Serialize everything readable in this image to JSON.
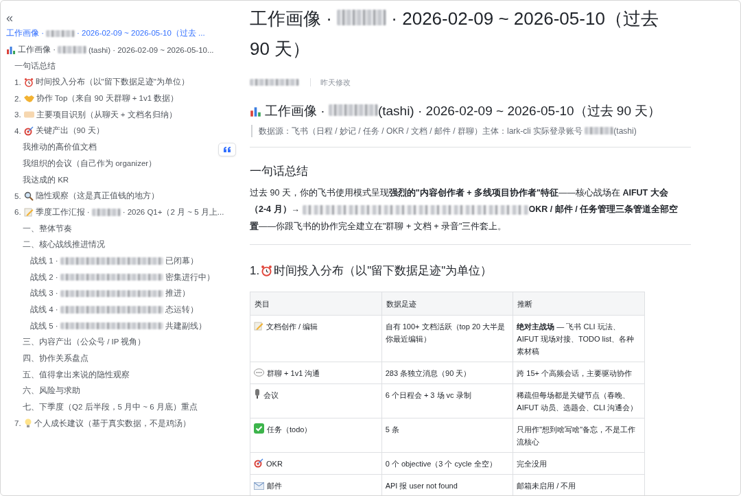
{
  "sidebar": {
    "collapse_glyph": "«",
    "items": [
      {
        "label": [
          {
            "kind": "text",
            "text": "工作画像 · "
          },
          {
            "kind": "redacted"
          },
          {
            "kind": "text",
            "text": " · 2026-02-09 ~ 2026-05-10（过去 ..."
          }
        ],
        "selected": true
      },
      {
        "label": [
          {
            "kind": "text",
            "text": "工作画像 · "
          },
          {
            "kind": "redacted"
          },
          {
            "kind": "text",
            "text": "(tashi) · 2026-02-09 ~ 2026-05-10..."
          }
        ],
        "selected": false,
        "children": [
          {
            "label": [
              {
                "kind": "text",
                "text": "一句话总结"
              }
            ],
            "selected": false
          },
          {
            "number": "1.",
            "label": [
              {
                "kind": "text",
                "text": "时间投入分布（以\"留下数据足迹\"为单位）"
              }
            ],
            "selected": false
          },
          {
            "number": "2.",
            "label": [
              {
                "kind": "text",
                "text": "协作 Top（来自 90 天群聊 + 1v1 数据）"
              }
            ],
            "selected": false
          },
          {
            "number": "3.",
            "label": [
              {
                "kind": "text",
                "text": "主要项目识别（从聊天 + 文档名归纳）"
              }
            ],
            "selected": false
          },
          {
            "number": "4.",
            "label": [
              {
                "kind": "text",
                "text": "关键产出（90 天）"
              }
            ],
            "selected": false,
            "children": [
              {
                "label": [
                  {
                    "kind": "text",
                    "text": "我推动的高价值文档"
                  }
                ],
                "selected": false
              },
              {
                "label": [
                  {
                    "kind": "text",
                    "text": "我组织的会议（自己作为 organizer）"
                  }
                ],
                "selected": false
              },
              {
                "label": [
                  {
                    "kind": "text",
                    "text": "我达成的 KR"
                  }
                ],
                "selected": false
              }
            ]
          },
          {
            "number": "5.",
            "label": [
              {
                "kind": "text",
                "text": "隐性观察（这是真正值钱的地方）"
              }
            ],
            "selected": false
          },
          {
            "number": "6.",
            "label": [
              {
                "kind": "text",
                "text": "季度工作汇报 · "
              },
              {
                "kind": "redacted"
              },
              {
                "kind": "text",
                "text": " · 2026 Q1+（2 月 ~ 5 月上..."
              }
            ],
            "selected": false,
            "children": [
              {
                "label": [
                  {
                    "kind": "text",
                    "text": "一、整体节奏"
                  }
                ],
                "selected": false
              },
              {
                "label": [
                  {
                    "kind": "text",
                    "text": "二、核心战线推进情况"
                  }
                ],
                "selected": false,
                "children": [
                  {
                    "label": [
                      {
                        "kind": "text",
                        "text": "战线 1 · "
                      },
                      {
                        "kind": "redacted"
                      },
                      {
                        "kind": "text",
                        "text": "已闭幕）"
                      }
                    ],
                    "selected": false
                  },
                  {
                    "label": [
                      {
                        "kind": "text",
                        "text": "战线 2 · "
                      },
                      {
                        "kind": "redacted"
                      },
                      {
                        "kind": "text",
                        "text": "密集进行中）"
                      }
                    ],
                    "selected": false
                  },
                  {
                    "label": [
                      {
                        "kind": "text",
                        "text": "战线 3 · "
                      },
                      {
                        "kind": "redacted"
                      },
                      {
                        "kind": "text",
                        "text": "推进）"
                      }
                    ],
                    "selected": false
                  },
                  {
                    "label": [
                      {
                        "kind": "text",
                        "text": "战线 4 · "
                      },
                      {
                        "kind": "redacted"
                      },
                      {
                        "kind": "text",
                        "text": "态运转）"
                      }
                    ],
                    "selected": false
                  },
                  {
                    "label": [
                      {
                        "kind": "text",
                        "text": "战线 5 · "
                      },
                      {
                        "kind": "redacted"
                      },
                      {
                        "kind": "text",
                        "text": "共建副线）"
                      }
                    ],
                    "selected": false
                  }
                ]
              },
              {
                "label": [
                  {
                    "kind": "text",
                    "text": "三、内容产出（公众号 / IP 视角）"
                  }
                ],
                "selected": false
              },
              {
                "label": [
                  {
                    "kind": "text",
                    "text": "四、协作关系盘点"
                  }
                ],
                "selected": false
              },
              {
                "label": [
                  {
                    "kind": "text",
                    "text": "五、值得拿出来说的隐性观察"
                  }
                ],
                "selected": false
              },
              {
                "label": [
                  {
                    "kind": "text",
                    "text": "六、风险与求助"
                  }
                ],
                "selected": false
              },
              {
                "label": [
                  {
                    "kind": "text",
                    "text": "七、下季度（Q2 后半段，5 月中 ~ 6 月底）重点"
                  }
                ],
                "selected": false
              }
            ]
          },
          {
            "number": "7.",
            "label": [
              {
                "kind": "text",
                "text": "个人成长建议（基于真实数据，不是鸡汤）"
              }
            ],
            "selected": false
          }
        ]
      }
    ]
  },
  "document": {
    "title": [
      {
        "kind": "text",
        "text": "工作画像 · "
      },
      {
        "kind": "redacted"
      },
      {
        "kind": "text",
        "text": " · 2026-02-09 ~ 2026-05-10（过去 90 天）"
      }
    ],
    "meta": {
      "author": [
        {
          "kind": "redacted"
        }
      ],
      "modified": "昨天修改"
    },
    "heading": [
      {
        "kind": "text",
        "text": "工作画像 · "
      },
      {
        "kind": "redacted"
      },
      {
        "kind": "text",
        "text": "(tashi) · 2026-02-09 ~ 2026-05-10（过去 90 天）"
      }
    ],
    "quote": [
      {
        "kind": "text",
        "text": "数据源：飞书（日程 / 妙记 / 任务 / OKR / 文档 / 邮件 / 群聊）主体：lark-cli 实际登录账号 "
      },
      {
        "kind": "redacted"
      },
      {
        "kind": "text",
        "text": "(tashi)"
      }
    ],
    "summary_heading": "一句话总结",
    "summary": [
      {
        "kind": "text",
        "text": "过去 90 天，你的飞书使用模式呈现**强烈的\"内容创作者 + 多线项目协作者\"特征**——核心战场在 **AIFUT 大会（2-4 月）→** "
      },
      {
        "kind": "redacted"
      },
      {
        "kind": "text",
        "text": " **OKR / 邮件 / 任务管理三条管道全部空置**——你跟飞书的协作完全建立在\"群聊 + 文档 + 录音\"三件套上。"
      }
    ],
    "section_heading": {
      "number": "1.",
      "text": "时间投入分布（以\"留下数据足迹\"为单位）"
    },
    "table": {
      "columns": [
        "类目",
        "数据足迹",
        "推断"
      ],
      "rows": [
        [
          "文档创作 / 编辑",
          "自有 100+ 文档活跃（top 20 大半是你最近编辑）",
          "**绝对主战场** — 飞书 CLI 玩法、AIFUT 现场对接、TODO list、各种素材稿"
        ],
        [
          "群聊 + 1v1 沟通",
          "283 条独立消息（90 天）",
          "跨 15+ 个高频会话，主要驱动协作"
        ],
        [
          "会议",
          "6 个日程会 + 3 场 vc 录制",
          "稀疏但每场都是关键节点（春晚、AIFUT 动员、选题会、CLI 沟通会）"
        ],
        [
          "任务（todo）",
          "5 条",
          "只用作\"想到啥写啥\"备忘，不是工作流核心"
        ],
        [
          "OKR",
          "0 个 objective（3 个 cycle 全空）",
          "完全没用"
        ],
        [
          "邮件",
          "API 报 user not found",
          "邮箱未启用 / 不用"
        ]
      ]
    }
  }
}
